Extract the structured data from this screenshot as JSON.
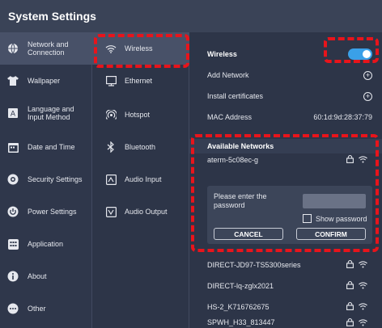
{
  "window": {
    "title": "System Settings"
  },
  "nav": [
    {
      "label": "Network and Connection",
      "icon": "globe-icon",
      "active": true
    },
    {
      "label": "Wallpaper",
      "icon": "shirt-icon",
      "active": false
    },
    {
      "label": "Language and Input Method",
      "icon": "language-icon",
      "active": false
    },
    {
      "label": "Date and Time",
      "icon": "calendar-icon",
      "active": false
    },
    {
      "label": "Security Settings",
      "icon": "security-gear-icon",
      "active": false
    },
    {
      "label": "Power Settings",
      "icon": "power-icon",
      "active": false
    },
    {
      "label": "Application",
      "icon": "application-grid-icon",
      "active": false
    },
    {
      "label": "About",
      "icon": "info-icon",
      "active": false
    },
    {
      "label": "Other",
      "icon": "more-icon",
      "active": false
    }
  ],
  "nav_labels": {
    "network": [
      "Network and",
      "Connection"
    ],
    "language": [
      "Language and",
      "Input Method"
    ]
  },
  "subnav": [
    {
      "label": "Wireless",
      "icon": "wifi-icon",
      "active": true
    },
    {
      "label": "Ethernet",
      "icon": "ethernet-icon",
      "active": false
    },
    {
      "label": "Hotspot",
      "icon": "hotspot-icon",
      "active": false
    },
    {
      "label": "Bluetooth",
      "icon": "bluetooth-icon",
      "active": false
    },
    {
      "label": "Audio Input",
      "icon": "audio-input-icon",
      "active": false
    },
    {
      "label": "Audio Output",
      "icon": "audio-output-icon",
      "active": false
    }
  ],
  "wireless": {
    "label": "Wireless",
    "enabled": true,
    "add_network": "Add Network",
    "install_certificates": "Install certificates",
    "mac_label": "MAC Address",
    "mac_value": "60:1d:9d:28:37:79"
  },
  "available": {
    "heading": "Available Networks",
    "selected_network": "aterm-5c08ec-g",
    "password_prompt": "Please enter the password",
    "password_prompt_lines": [
      "Please enter the",
      "password"
    ],
    "password_value": "",
    "show_password": "Show password",
    "cancel": "CANCEL",
    "confirm": "CONFIRM",
    "networks": [
      "DIRECT-JD97-TS5300series",
      "DIRECT-lq-zglx2021",
      "HS-2_K716762675",
      "SPWH_H33_813447"
    ]
  },
  "colors": {
    "accent": "#3aa0e8",
    "highlight_dash": "#e8141b",
    "background": "#2d3548",
    "selected": "#485168"
  }
}
